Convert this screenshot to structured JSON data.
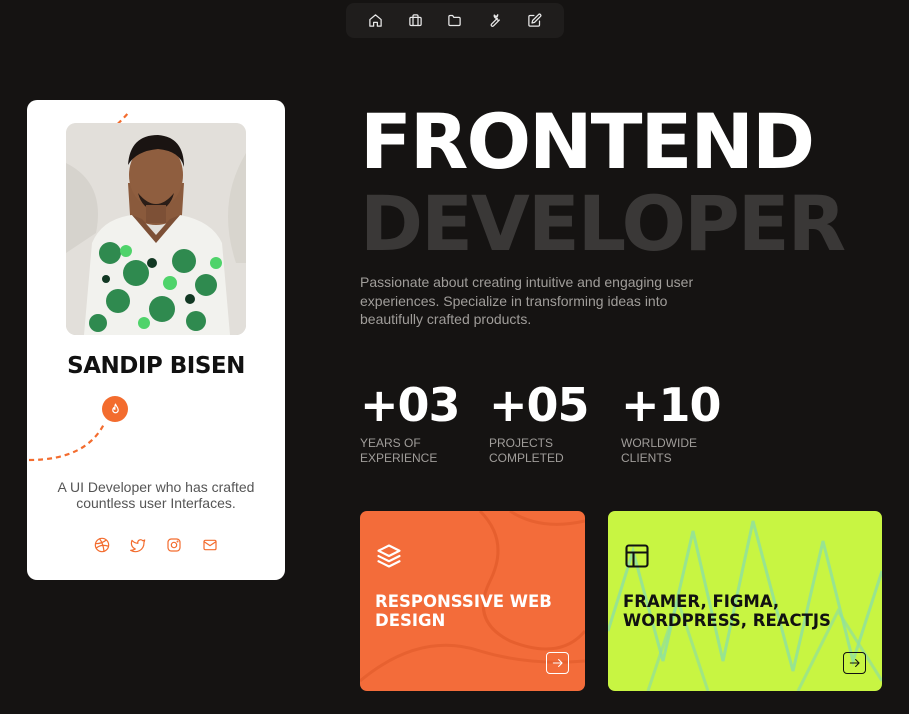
{
  "nav": {
    "items": [
      {
        "icon": "home-icon"
      },
      {
        "icon": "briefcase-icon"
      },
      {
        "icon": "folder-icon"
      },
      {
        "icon": "wrench-icon"
      },
      {
        "icon": "edit-icon"
      }
    ]
  },
  "profile": {
    "name": "SANDIP BISEN",
    "bio": "A UI Developer who has crafted countless user Interfaces.",
    "badge_icon": "flame-icon",
    "socials": [
      "dribbble-icon",
      "twitter-icon",
      "instagram-icon",
      "mail-icon"
    ]
  },
  "hero": {
    "title_line1": "FRONTEND",
    "title_line2": "DEVELOPER",
    "intro": "Passionate about creating intuitive and engaging user experiences. Specialize in transforming ideas into beautifully crafted products."
  },
  "stats": [
    {
      "value": "+03",
      "label": "Years of Experience"
    },
    {
      "value": "+05",
      "label": "Projects Completed"
    },
    {
      "value": "+10",
      "label": "Worldwide Clients"
    }
  ],
  "cards": [
    {
      "title": "RESPONSSIVE WEB DESIGN",
      "icon": "layers-icon",
      "color": "#f36c3a"
    },
    {
      "title": "FRAMER, FIGMA, WORDPRESS, REACTJS",
      "icon": "layout-icon",
      "color": "#c8f542"
    }
  ],
  "colors": {
    "accent": "#f36c2e",
    "background": "#151312",
    "lime": "#c8f542"
  }
}
